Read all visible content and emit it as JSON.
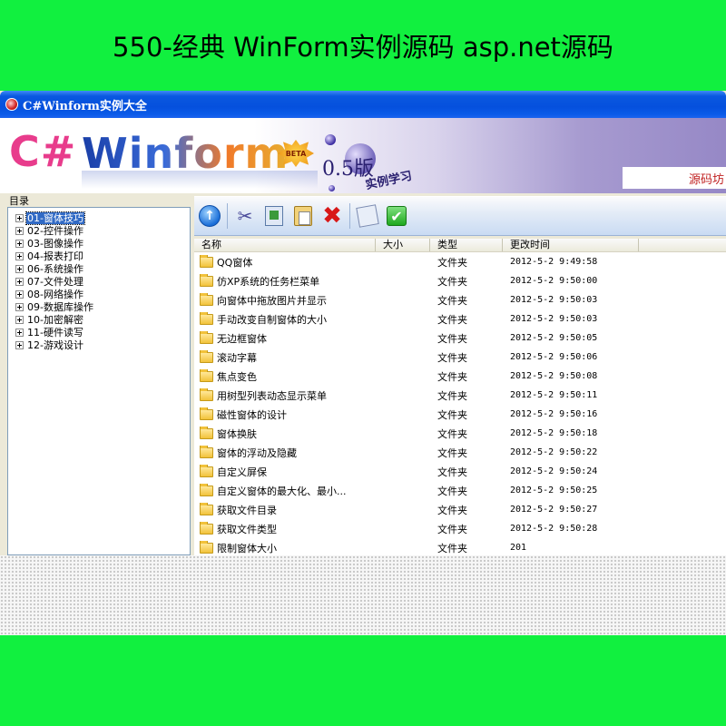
{
  "banner": {
    "text": "550-经典 WinForm实例源码 asp.net源码"
  },
  "window": {
    "title": "C#Winform实例大全"
  },
  "logo": {
    "part1": "C#",
    "part2": "Winform",
    "badge": "BETA",
    "version": "0.5版",
    "tagline": "实例学习",
    "source": "源码坊"
  },
  "tree": {
    "label": "目录",
    "items": [
      "01-窗体技巧",
      "02-控件操作",
      "03-图像操作",
      "04-报表打印",
      "06-系统操作",
      "07-文件处理",
      "08-网络操作",
      "09-数据库操作",
      "10-加密解密",
      "11-硬件读写",
      "12-游戏设计"
    ],
    "selected_index": 0
  },
  "toolbar": {
    "icons": [
      "back-icon",
      "cut-icon",
      "copy-icon",
      "paste-icon",
      "delete-icon",
      "properties-icon",
      "confirm-icon"
    ]
  },
  "list": {
    "columns": {
      "name": "名称",
      "size": "大小",
      "type": "类型",
      "time": "更改时间"
    },
    "rows": [
      {
        "name": "QQ窗体",
        "type": "文件夹",
        "time": "2012-5-2 9:49:58"
      },
      {
        "name": "仿XP系统的任务栏菜单",
        "type": "文件夹",
        "time": "2012-5-2 9:50:00"
      },
      {
        "name": "向窗体中拖放图片并显示",
        "type": "文件夹",
        "time": "2012-5-2 9:50:03"
      },
      {
        "name": "手动改变自制窗体的大小",
        "type": "文件夹",
        "time": "2012-5-2 9:50:03"
      },
      {
        "name": "无边框窗体",
        "type": "文件夹",
        "time": "2012-5-2 9:50:05"
      },
      {
        "name": "滚动字幕",
        "type": "文件夹",
        "time": "2012-5-2 9:50:06"
      },
      {
        "name": "焦点变色",
        "type": "文件夹",
        "time": "2012-5-2 9:50:08"
      },
      {
        "name": "用树型列表动态显示菜单",
        "type": "文件夹",
        "time": "2012-5-2 9:50:11"
      },
      {
        "name": "磁性窗体的设计",
        "type": "文件夹",
        "time": "2012-5-2 9:50:16"
      },
      {
        "name": "窗体换肤",
        "type": "文件夹",
        "time": "2012-5-2 9:50:18"
      },
      {
        "name": "窗体的浮动及隐藏",
        "type": "文件夹",
        "time": "2012-5-2 9:50:22"
      },
      {
        "name": "自定义屏保",
        "type": "文件夹",
        "time": "2012-5-2 9:50:24"
      },
      {
        "name": "自定义窗体的最大化、最小...",
        "type": "文件夹",
        "time": "2012-5-2 9:50:25"
      },
      {
        "name": "获取文件目录",
        "type": "文件夹",
        "time": "2012-5-2 9:50:27"
      },
      {
        "name": "获取文件类型",
        "type": "文件夹",
        "time": "2012-5-2 9:50:28"
      },
      {
        "name": "限制窗体大小",
        "type": "文件夹",
        "time": "201"
      }
    ]
  },
  "colors": {
    "background": "#11f03f",
    "titlebar": "#0550dd",
    "selection": "#316ac5"
  }
}
